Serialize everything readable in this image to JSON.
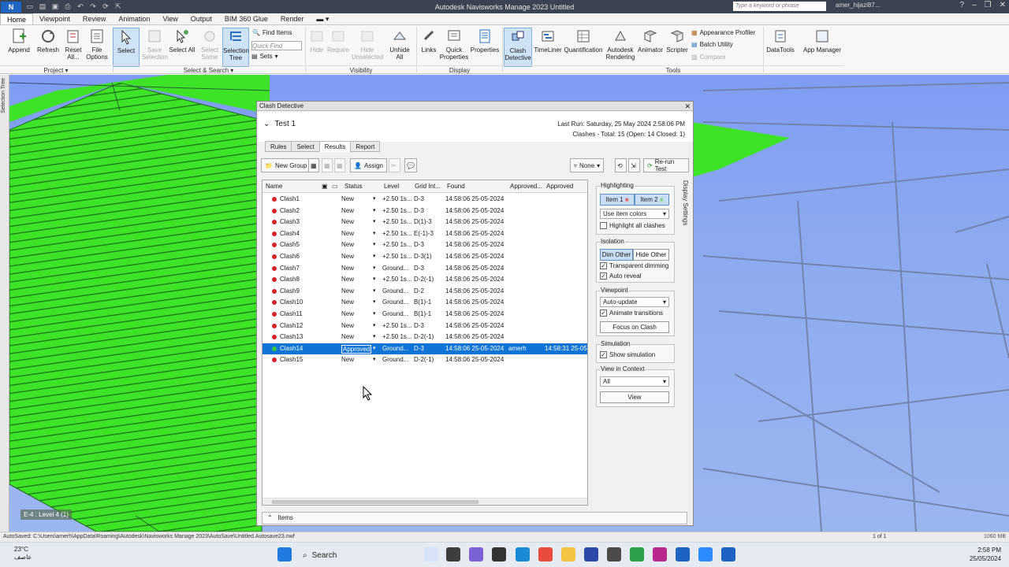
{
  "titlebar": {
    "logo": "N NWS",
    "title": "Autodesk Navisworks Manage 2023    Untitled",
    "search_placeholder": "Type a keyword or phrase",
    "user": "amer_hijazi87..."
  },
  "tabs": [
    "Home",
    "Viewpoint",
    "Review",
    "Animation",
    "View",
    "Output",
    "BIM 360 Glue",
    "Render"
  ],
  "ribbon": {
    "append": "Append",
    "refresh": "Refresh",
    "reset_all": "Reset All...",
    "file_options": "File Options",
    "select": "Select",
    "save_selection": "Save Selection",
    "select_all": "Select All",
    "select_same": "Select Same",
    "selection_tree": "Selection Tree",
    "find_items": "Find Items",
    "quick_find_placeholder": "Quick Find",
    "sets": "Sets",
    "hide": "Hide",
    "require": "Require",
    "hide_unselected": "Hide Unselected",
    "unhide_all": "Unhide All",
    "links": "Links",
    "quick_properties": "Quick Properties",
    "properties": "Properties",
    "clash_detective": "Clash Detective",
    "timeliner": "TimeLiner",
    "quantification": "Quantification",
    "autodesk_rendering": "Autodesk Rendering",
    "animator": "Animator",
    "scripter": "Scripter",
    "appearance_profiler": "Appearance Profiler",
    "batch_utility": "Batch Utility",
    "compare": "Compare",
    "datatools": "DataTools",
    "app_manager": "App Manager",
    "groups": {
      "project": "Project",
      "select_search": "Select & Search",
      "visibility": "Visibility",
      "display": "Display",
      "tools": "Tools"
    }
  },
  "left_strip": "Selection Tree",
  "viewport_label": "E-4 : Level 4 (1)",
  "clash": {
    "window_title": "Clash Detective",
    "test_name": "Test 1",
    "last_run": "Last Run:  Saturday, 25 May 2024 2:58:06 PM",
    "clashes_summary": "Clashes - Total:  15  (Open:  14  Closed:  1)",
    "tabs": [
      "Rules",
      "Select",
      "Results",
      "Report"
    ],
    "toolbar": {
      "new_group": "New Group",
      "assign": "Assign",
      "none": "None",
      "rerun": "Re-run Test"
    },
    "columns": [
      "Name",
      "Status",
      "Level",
      "Grid Int...",
      "Found",
      "Approved...",
      "Approved"
    ],
    "rows": [
      {
        "name": "Clash1",
        "status": "New",
        "level": "+2.50 1s...",
        "grid": "D-3",
        "found": "14:58:06 25-05-2024",
        "approved_by": "",
        "approved": ""
      },
      {
        "name": "Clash2",
        "status": "New",
        "level": "+2.50 1s...",
        "grid": "D-3",
        "found": "14:58:06 25-05-2024",
        "approved_by": "",
        "approved": ""
      },
      {
        "name": "Clash3",
        "status": "New",
        "level": "+2.50 1s...",
        "grid": "D(1)-3",
        "found": "14:58:06 25-05-2024",
        "approved_by": "",
        "approved": ""
      },
      {
        "name": "Clash4",
        "status": "New",
        "level": "+2.50 1s...",
        "grid": "E(-1)-3",
        "found": "14:58:06 25-05-2024",
        "approved_by": "",
        "approved": ""
      },
      {
        "name": "Clash5",
        "status": "New",
        "level": "+2.50 1s...",
        "grid": "D-3",
        "found": "14:58:06 25-05-2024",
        "approved_by": "",
        "approved": ""
      },
      {
        "name": "Clash6",
        "status": "New",
        "level": "+2.50 1s...",
        "grid": "D-3(1)",
        "found": "14:58:06 25-05-2024",
        "approved_by": "",
        "approved": ""
      },
      {
        "name": "Clash7",
        "status": "New",
        "level": "Ground...",
        "grid": "D-3",
        "found": "14:58:06 25-05-2024",
        "approved_by": "",
        "approved": ""
      },
      {
        "name": "Clash8",
        "status": "New",
        "level": "+2.50 1s...",
        "grid": "D-2(-1)",
        "found": "14:58:06 25-05-2024",
        "approved_by": "",
        "approved": ""
      },
      {
        "name": "Clash9",
        "status": "New",
        "level": "Ground...",
        "grid": "D-2",
        "found": "14:58:06 25-05-2024",
        "approved_by": "",
        "approved": ""
      },
      {
        "name": "Clash10",
        "status": "New",
        "level": "Ground...",
        "grid": "B(1)-1",
        "found": "14:58:06 25-05-2024",
        "approved_by": "",
        "approved": ""
      },
      {
        "name": "Clash11",
        "status": "New",
        "level": "Ground...",
        "grid": "B(1)-1",
        "found": "14:58:06 25-05-2024",
        "approved_by": "",
        "approved": ""
      },
      {
        "name": "Clash12",
        "status": "New",
        "level": "+2.50 1s...",
        "grid": "D-3",
        "found": "14:58:06 25-05-2024",
        "approved_by": "",
        "approved": ""
      },
      {
        "name": "Clash13",
        "status": "New",
        "level": "+2.50 1s...",
        "grid": "D-2(-1)",
        "found": "14:58:06 25-05-2024",
        "approved_by": "",
        "approved": ""
      },
      {
        "name": "Clash14",
        "status": "Approved",
        "level": "Ground...",
        "grid": "D-3",
        "found": "14:58:06 25-05-2024",
        "approved_by": "amerh",
        "approved": "14:58:31 25-05-"
      },
      {
        "name": "Clash15",
        "status": "New",
        "level": "Ground...",
        "grid": "D-2(-1)",
        "found": "14:58:06 25-05-2024",
        "approved_by": "",
        "approved": ""
      }
    ],
    "display_settings": {
      "side_label": "Display Settings",
      "highlighting": "Highlighting",
      "item1": "Item 1",
      "item2": "Item 2",
      "color_mode": "Use item colors",
      "highlight_all": "Highlight all clashes",
      "isolation": "Isolation",
      "dim_other": "Dim Other",
      "hide_other": "Hide Other",
      "transparent_dimming": "Transparent dimming",
      "auto_reveal": "Auto reveal",
      "viewpoint": "Viewpoint",
      "viewpoint_mode": "Auto-update",
      "animate_transitions": "Animate transitions",
      "focus_on_clash": "Focus on Clash",
      "simulation": "Simulation",
      "show_simulation": "Show simulation",
      "view_in_context": "View in Context",
      "context_value": "All",
      "view": "View"
    },
    "items_label": "Items"
  },
  "statusbar": {
    "path": "AutoSaved: C:\\Users\\amerh\\AppData\\Roaming\\Autodesk\\Navisworks Manage 2023\\AutoSave\\Untitled.Autosave23.nwf",
    "page": "1 of 1",
    "memory": "1060 MB"
  },
  "taskbar": {
    "temperature": "23°C",
    "weather": "عاصف",
    "search": "Search",
    "time": "2:58 PM",
    "date": "25/05/2024"
  },
  "colors": {
    "accent": "#0f74d6",
    "clash_red": "#d4232b",
    "approved_green": "#36c43a",
    "floor_green": "#37e21f"
  }
}
